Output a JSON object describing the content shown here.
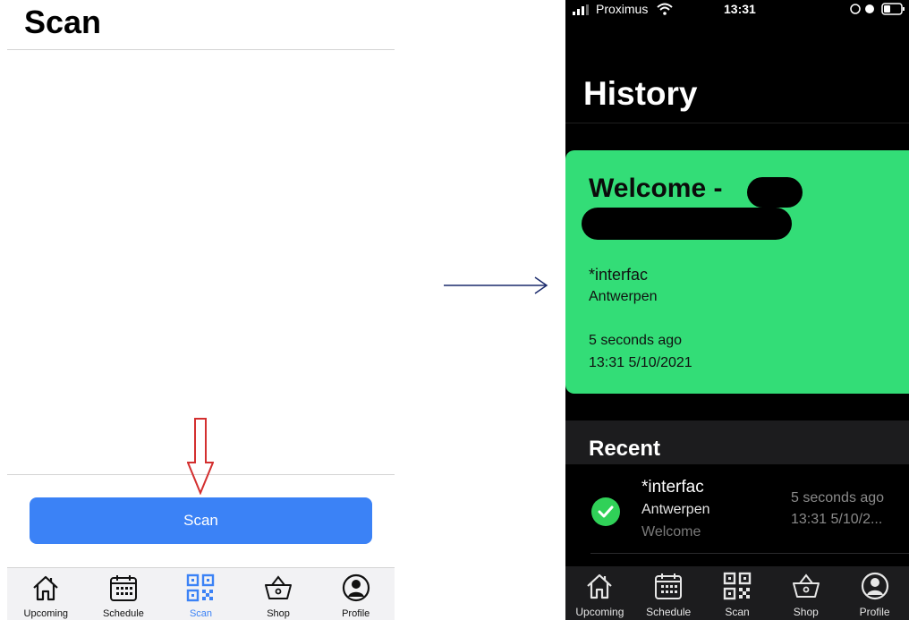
{
  "left": {
    "title": "Scan",
    "scan_button_label": "Scan",
    "tabs": [
      {
        "label": "Upcoming",
        "icon": "home-icon"
      },
      {
        "label": "Schedule",
        "icon": "calendar-icon"
      },
      {
        "label": "Scan",
        "icon": "qr-code-icon",
        "active": true
      },
      {
        "label": "Shop",
        "icon": "basket-icon"
      },
      {
        "label": "Profile",
        "icon": "profile-icon"
      }
    ]
  },
  "right": {
    "status_bar": {
      "carrier": "Proximus",
      "time": "13:31"
    },
    "title": "History",
    "welcome_card": {
      "heading": "Welcome -",
      "location_name": "*interfac",
      "city": "Antwerpen",
      "relative_time": "5 seconds ago",
      "timestamp": "13:31 5/10/2021"
    },
    "recent": {
      "heading": "Recent",
      "items": [
        {
          "location_name": "*interfac",
          "city": "Antwerpen",
          "tag": "Welcome",
          "relative_time": "5 seconds ago",
          "timestamp": "13:31 5/10/2..."
        }
      ]
    },
    "tabs": [
      {
        "label": "Upcoming",
        "icon": "home-icon"
      },
      {
        "label": "Schedule",
        "icon": "calendar-icon"
      },
      {
        "label": "Scan",
        "icon": "qr-code-icon"
      },
      {
        "label": "Shop",
        "icon": "basket-icon"
      },
      {
        "label": "Profile",
        "icon": "profile-icon"
      }
    ]
  },
  "colors": {
    "accent_blue": "#3b82f6",
    "card_green": "#33dd77",
    "check_green": "#30d158",
    "arrow_red": "#d32f2f",
    "arrow_navy": "#1a2a6c"
  }
}
